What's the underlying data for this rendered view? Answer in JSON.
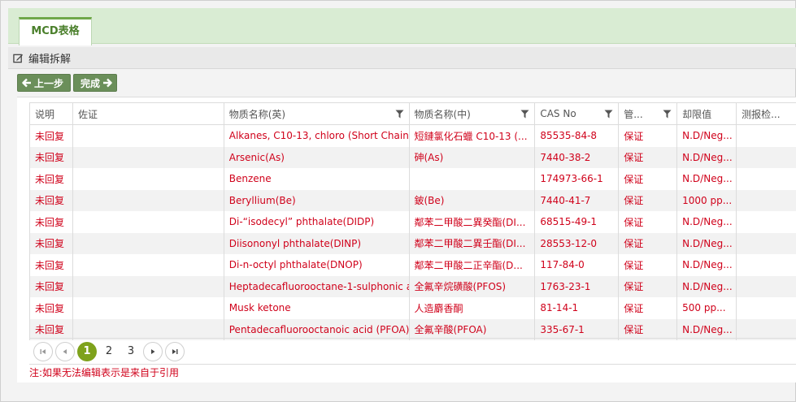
{
  "tab": {
    "label": "MCD表格"
  },
  "section": {
    "title": "编辑拆解",
    "icon": "edit-icon"
  },
  "toolbar": {
    "prev_label": "上一步",
    "done_label": "完成"
  },
  "table": {
    "columns": [
      "说明",
      "佐证",
      "物质名称(英)",
      "物质名称(中)",
      "CAS No",
      "管...",
      "却限值",
      "测报检..."
    ],
    "filterable_columns": [
      2,
      3,
      4,
      5
    ],
    "rows": [
      [
        "未回复",
        "",
        "Alkanes, C10-13, chloro (Short Chain...",
        "短鏈氯化石蠟 C10-13 (...",
        "85535-84-8",
        "保证",
        "N.D/Neg...",
        ""
      ],
      [
        "未回复",
        "",
        "Arsenic(As)",
        "砷(As)",
        "7440-38-2",
        "保证",
        "N.D/Neg...",
        ""
      ],
      [
        "未回复",
        "",
        "Benzene",
        "",
        "174973-66-1",
        "保证",
        "N.D/Neg...",
        ""
      ],
      [
        "未回复",
        "",
        "Beryllium(Be)",
        "鈹(Be)",
        "7440-41-7",
        "保证",
        "1000 pp...",
        ""
      ],
      [
        "未回复",
        "",
        "Di-“isodecyl” phthalate(DIDP)",
        "鄰苯二甲酸二異癸酯(DI...",
        "68515-49-1",
        "保证",
        "N.D/Neg...",
        ""
      ],
      [
        "未回复",
        "",
        "Diisononyl phthalate(DINP)",
        "鄰苯二甲酸二異壬酯(DI...",
        "28553-12-0",
        "保证",
        "N.D/Neg...",
        ""
      ],
      [
        "未回复",
        "",
        "Di-n-octyl phthalate(DNOP)",
        "鄰苯二甲酸二正辛酯(D...",
        "117-84-0",
        "保证",
        "N.D/Neg...",
        ""
      ],
      [
        "未回复",
        "",
        "Heptadecafluorooctane-1-sulphonic a...",
        "全氟辛烷磺酸(PFOS)",
        "1763-23-1",
        "保证",
        "N.D/Neg...",
        ""
      ],
      [
        "未回复",
        "",
        "Musk ketone",
        "人造麝香酮",
        "81-14-1",
        "保证",
        "500 pp...",
        ""
      ],
      [
        "未回复",
        "",
        "Pentadecafluorooctanoic acid (PFOA)",
        "全氟辛酸(PFOA)",
        "335-67-1",
        "保证",
        "N.D/Neg...",
        ""
      ]
    ]
  },
  "pager": {
    "pages": [
      "1",
      "2",
      "3"
    ],
    "current": "1"
  },
  "note": "注:如果无法编辑表示是来自于引用",
  "colors": {
    "accent": "#6fa84a",
    "text_red": "#d0021b",
    "button": "#6b8f5a",
    "page_active": "#7ea21c"
  }
}
